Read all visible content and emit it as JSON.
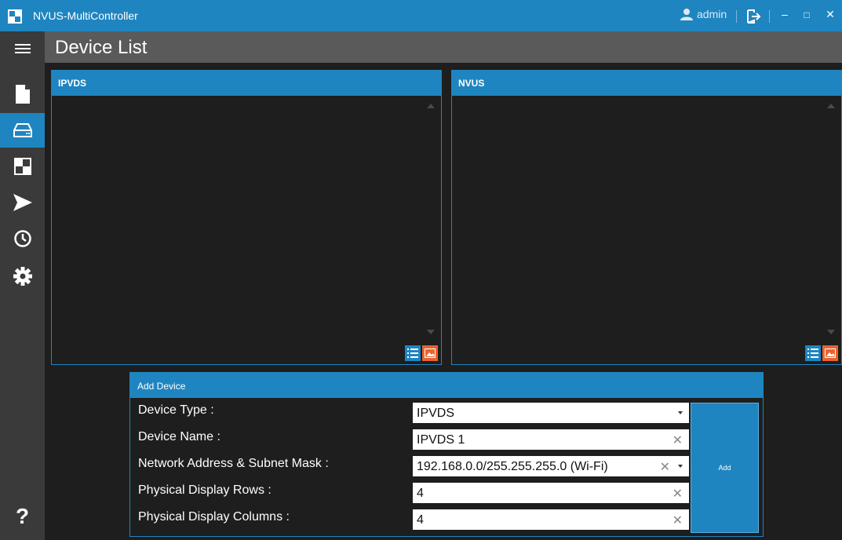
{
  "window": {
    "title": "NVUS-MultiController",
    "user": "admin",
    "minimize": "–",
    "maximize": "□",
    "close": "✕"
  },
  "header": {
    "page_title": "Device List"
  },
  "sidebar": {
    "items": [
      {
        "icon": "document-icon",
        "active": false
      },
      {
        "icon": "device-drive-icon",
        "active": true
      },
      {
        "icon": "layout-icon",
        "active": false
      },
      {
        "icon": "send-icon",
        "active": false
      },
      {
        "icon": "clock-icon",
        "active": false
      },
      {
        "icon": "gear-icon",
        "active": false
      }
    ],
    "help": "?"
  },
  "panels": {
    "ipvds": {
      "title": "IPVDS"
    },
    "nvus": {
      "title": "NVUS"
    }
  },
  "add_device": {
    "title": "Add Device",
    "rows": [
      {
        "label": "Device Type :",
        "value": "IPVDS"
      },
      {
        "label": "Device Name :",
        "value": "IPVDS 1"
      },
      {
        "label": "Network Address & Subnet Mask :",
        "value": "192.168.0.0/255.255.255.0 (Wi-Fi)"
      },
      {
        "label": "Physical Display Rows :",
        "value": "4"
      },
      {
        "label": "Physical Display Columns :",
        "value": "4"
      }
    ],
    "add_label": "Add"
  },
  "colors": {
    "accent": "#1f85c0",
    "orange": "#e8622e",
    "sidebar": "#3a3a3a",
    "header": "#5a5a5a"
  }
}
